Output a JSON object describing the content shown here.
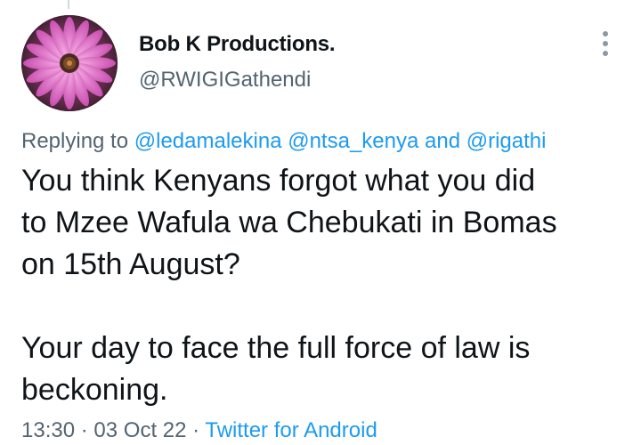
{
  "author": {
    "display_name": "Bob K Productions.",
    "handle": "@RWIGIGathendi",
    "avatar_icon": "purple-daisy-flower-avatar"
  },
  "reply_context": {
    "prefix": "Replying to",
    "mention_1": "@ledamalekina",
    "mention_2": "@ntsa_kenya",
    "joiner": "and",
    "mention_3": "@rigathi"
  },
  "tweet": {
    "paragraph_1_line_1": "You think Kenyans forgot what you did",
    "paragraph_1_line_2": "to Mzee Wafula wa Chebukati in Bomas",
    "paragraph_1_line_3": "on 15th August?",
    "paragraph_2_line_1": "Your day to face the full force of law is",
    "paragraph_2_line_2": "beckoning."
  },
  "meta": {
    "time": "13:30",
    "separator": "·",
    "date": "03 Oct 22",
    "source": "Twitter for Android"
  },
  "colors": {
    "text": "#0f1419",
    "secondary": "#536471",
    "link": "#1d9bf0"
  }
}
